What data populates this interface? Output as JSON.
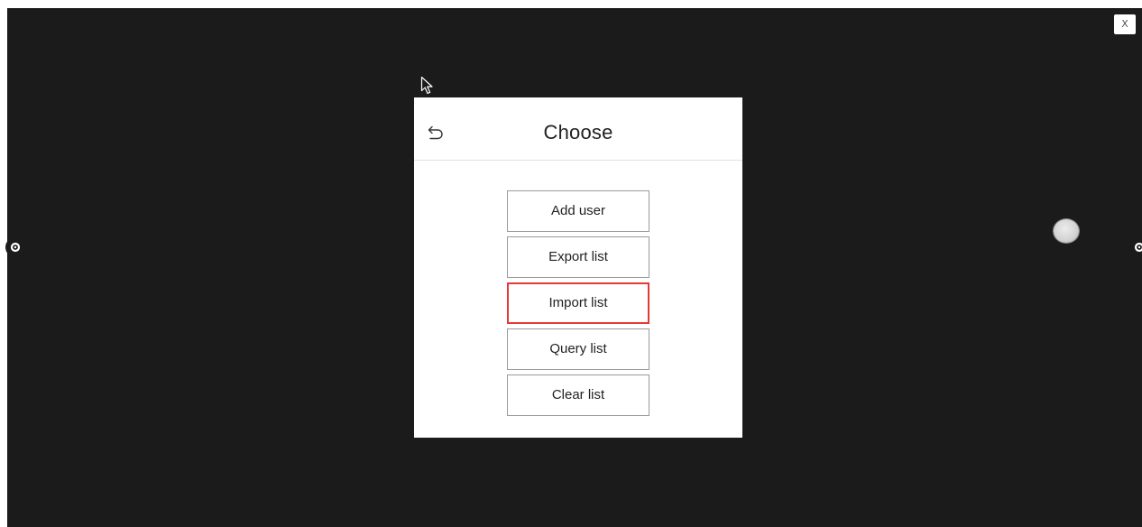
{
  "window": {
    "close_label": "X"
  },
  "dialog": {
    "title": "Choose",
    "back_icon": "undo-arrow-icon",
    "buttons": [
      {
        "label": "Add user"
      },
      {
        "label": "Export list"
      },
      {
        "label": "Import list",
        "highlighted": true
      },
      {
        "label": "Query list"
      },
      {
        "label": "Clear list"
      }
    ]
  },
  "colors": {
    "background": "#1b1b1b",
    "dialog": "#ffffff",
    "highlight": "#e53935"
  },
  "icons": {
    "left_handle": "settings-dot-icon",
    "right_handle": "settings-dot-icon",
    "floating": "floating-ball-icon",
    "pointer": "mouse-cursor-icon"
  }
}
